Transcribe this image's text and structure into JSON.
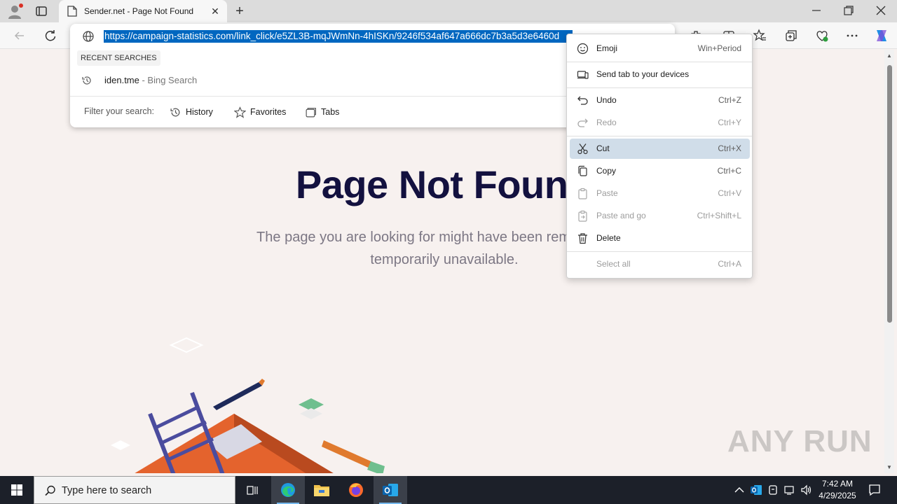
{
  "browser": {
    "tab_title": "Sender.net - Page Not Found",
    "url": "https://campaign-statistics.com/link_click/e5ZL3B-mqJWmNn-4hISKn/9246f534af647a666dc7b3a5d3e6460d"
  },
  "omnibox": {
    "recent_label": "RECENT SEARCHES",
    "suggestion_text": "iden.tme",
    "suggestion_sub": " - Bing Search",
    "filter_label": "Filter your search:",
    "filters": [
      "History",
      "Favorites",
      "Tabs"
    ]
  },
  "page": {
    "heading": "Page Not Found",
    "subtext_line1": "The page you are looking for might have been removed, had",
    "subtext_line2": "temporarily unavailable."
  },
  "context_menu": {
    "items": [
      {
        "label": "Emoji",
        "key": "Win+Period",
        "icon": "emoji-icon"
      },
      {
        "label": "Send tab to your devices",
        "key": "",
        "icon": "send-tab-icon"
      },
      {
        "label": "Undo",
        "key": "Ctrl+Z",
        "icon": "undo-icon"
      },
      {
        "label": "Redo",
        "key": "Ctrl+Y",
        "icon": "redo-icon"
      },
      {
        "label": "Cut",
        "key": "Ctrl+X",
        "icon": "cut-icon"
      },
      {
        "label": "Copy",
        "key": "Ctrl+C",
        "icon": "copy-icon"
      },
      {
        "label": "Paste",
        "key": "Ctrl+V",
        "icon": "paste-icon"
      },
      {
        "label": "Paste and go",
        "key": "Ctrl+Shift+L",
        "icon": "paste-go-icon"
      },
      {
        "label": "Delete",
        "key": "",
        "icon": "delete-icon"
      },
      {
        "label": "Select all",
        "key": "Ctrl+A",
        "icon": ""
      }
    ]
  },
  "watermark": "ANY RUN",
  "taskbar": {
    "search_placeholder": "Type here to search",
    "time": "7:42 AM",
    "date": "4/29/2025"
  },
  "colors": {
    "selection": "#0067c0",
    "heading": "#13113f",
    "menu_highlight": "#d0dde9",
    "taskbar": "#1c2029"
  }
}
